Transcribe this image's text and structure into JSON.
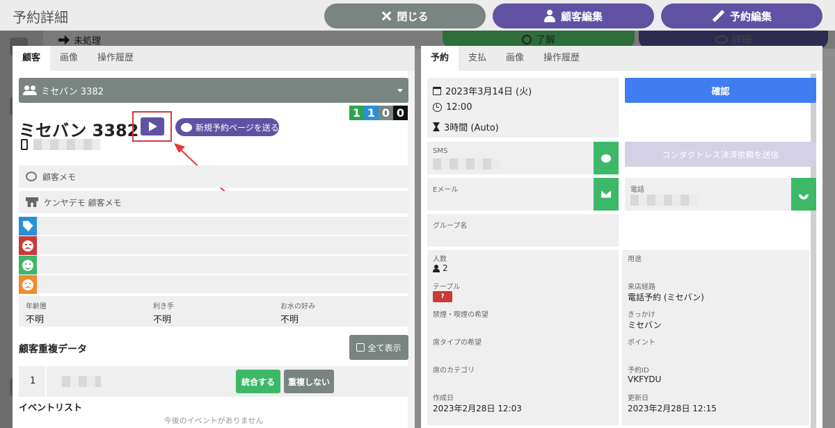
{
  "header": {
    "title": "予約詳細",
    "close_label": "閉じる",
    "customer_edit_label": "顧客編集",
    "reservation_edit_label": "予約編集"
  },
  "background": {
    "status_label": "未処理",
    "ok_label": "了解",
    "detail_label": "詳細"
  },
  "left": {
    "tabs": [
      {
        "label": "顧客"
      },
      {
        "label": "画像"
      },
      {
        "label": "操作履歴"
      }
    ],
    "customer_select": "ミセバン 3382",
    "customer_name": "ミセバン 3382",
    "send_page_label": "新規予約ページを送る",
    "counts": [
      {
        "value": "1",
        "color": "#2ea44f"
      },
      {
        "value": "1",
        "color": "#2b8fd6"
      },
      {
        "value": "0",
        "color": "#7a8480"
      },
      {
        "value": "0",
        "color": "#111111"
      }
    ],
    "memo_label": "顧客メモ",
    "shop_memo_label": "ケンヤデモ 顧客メモ",
    "tag_colors": {
      "tag": "#2b8fd6",
      "angry": "#c93a3a",
      "happy": "#3cb868",
      "sad": "#f08c2b"
    },
    "attributes": [
      {
        "label": "年齢層",
        "value": "不明"
      },
      {
        "label": "利き手",
        "value": "不明"
      },
      {
        "label": "お水の好み",
        "value": "不明"
      }
    ],
    "duplicate_title": "顧客重複データ",
    "show_all_label": "全て表示",
    "duplicate_row_number": "1",
    "merge_label": "統合する",
    "no_duplicate_label": "重複しない",
    "event_title": "イベントリスト",
    "no_event_text": "今後のイベントがありません"
  },
  "right": {
    "tabs": [
      {
        "label": "予約"
      },
      {
        "label": "支払"
      },
      {
        "label": "画像"
      },
      {
        "label": "操作履歴"
      }
    ],
    "date": "2023年3月14日 (火)",
    "time": "12:00",
    "duration": "3時間 (Auto)",
    "confirm_label": "確認",
    "sms_label": "SMS",
    "contactless_label": "コンタクトレス決済依頼を送信",
    "email_label": "Eメール",
    "phone_label": "電話",
    "group_label": "グループ名",
    "grid": [
      {
        "label": "人数",
        "value": "2"
      },
      {
        "label": "用途",
        "value": ""
      },
      {
        "label": "テーブル",
        "value": ""
      },
      {
        "label": "来店経路",
        "value": "電話予約 (ミセバン)"
      },
      {
        "label": "禁煙・喫煙の希望",
        "value": ""
      },
      {
        "label": "きっかけ",
        "value": "ミセバン"
      },
      {
        "label": "席タイプの希望",
        "value": ""
      },
      {
        "label": "ポイント",
        "value": ""
      },
      {
        "label": "席のカテゴリ",
        "value": ""
      },
      {
        "label": "予約ID",
        "value": "VKFYDU"
      },
      {
        "label": "作成日",
        "value": "2023年2月28日 12:03"
      },
      {
        "label": "更新日",
        "value": "2023年2月28日 12:15"
      }
    ],
    "table_badge": "?"
  }
}
